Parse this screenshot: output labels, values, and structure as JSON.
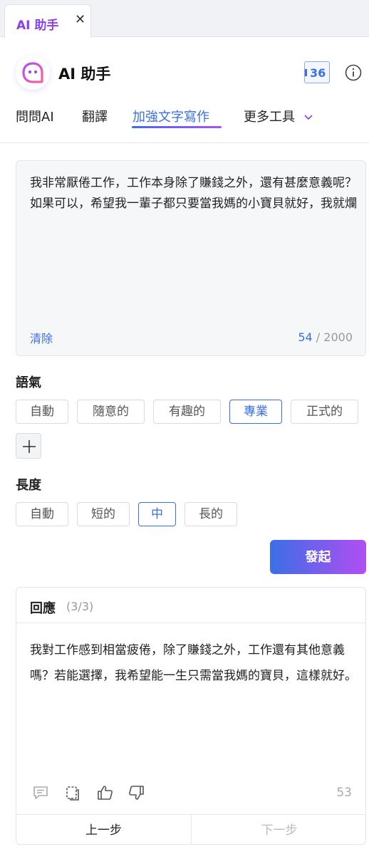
{
  "tab": {
    "label": "AI 助手",
    "close_icon": "close-icon"
  },
  "header": {
    "title": "AI 助手",
    "logo_icon": "ai-assistant-logo-icon",
    "credits": "36",
    "info_icon": "info-icon"
  },
  "nav": {
    "items": [
      {
        "label": "問問AI"
      },
      {
        "label": "翻譯"
      },
      {
        "label": "加強文字寫作"
      },
      {
        "label": "更多工具"
      }
    ],
    "active_index": 2
  },
  "input": {
    "text": "我非常厭倦工作，工作本身除了賺錢之外，還有甚麼意義呢？如果可以，希望我一輩子都只要當我媽的小寶貝就好，我就爛",
    "clear_label": "清除",
    "count_current": "54",
    "count_max": "/ 2000"
  },
  "tone": {
    "title": "語氣",
    "options": [
      "自動",
      "隨意的",
      "有趣的",
      "專業",
      "正式的"
    ],
    "selected": "專業",
    "add_icon": "plus-icon"
  },
  "length": {
    "title": "長度",
    "options": [
      "自動",
      "短的",
      "中",
      "長的"
    ],
    "selected": "中"
  },
  "submit_label": "發起",
  "response": {
    "title": "回應",
    "count": "(3/3)",
    "text": "我對工作感到相當疲倦，除了賺錢之外，工作還有其他意義嗎？若能選擇，我希望能一生只需當我媽的寶貝，這樣就好。",
    "word_count": "53",
    "prev_label": "上一步",
    "next_label": "下一步"
  },
  "colors": {
    "accent": "#3b6fe6",
    "accent_purple": "#b14ef2",
    "tab_text": "#8a3ff0"
  }
}
